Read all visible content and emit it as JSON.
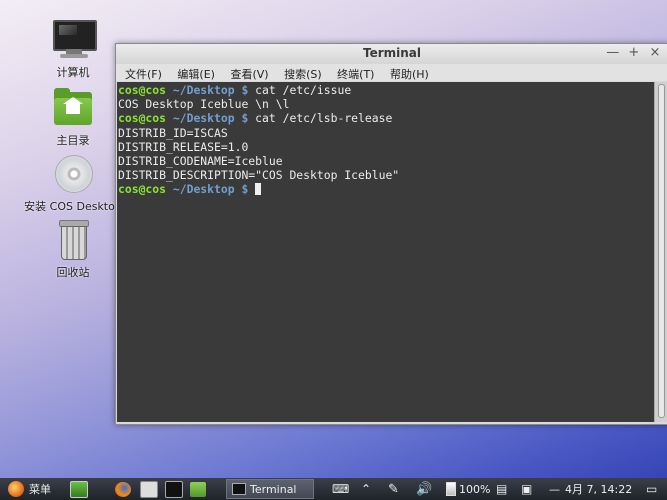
{
  "desktop": {
    "icons": [
      {
        "label": "计算机"
      },
      {
        "label": "主目录"
      },
      {
        "label": "安装 COS Desktop"
      },
      {
        "label": "回收站"
      }
    ]
  },
  "window": {
    "title": "Terminal",
    "buttons": {
      "minimize": "—",
      "maximize": "+",
      "close": "×"
    },
    "menu": [
      "文件(F)",
      "编辑(E)",
      "查看(V)",
      "搜索(S)",
      "终端(T)",
      "帮助(H)"
    ]
  },
  "terminal": {
    "prompt_user": "cos@cos",
    "prompt_path": "~/Desktop $",
    "lines": [
      {
        "type": "cmd",
        "text": " cat /etc/issue"
      },
      {
        "type": "out",
        "text": "COS Desktop Iceblue \\n \\l"
      },
      {
        "type": "cmd",
        "text": " cat /etc/lsb-release"
      },
      {
        "type": "out",
        "text": "DISTRIB_ID=ISCAS"
      },
      {
        "type": "out",
        "text": "DISTRIB_RELEASE=1.0"
      },
      {
        "type": "out",
        "text": "DISTRIB_CODENAME=Iceblue"
      },
      {
        "type": "out",
        "text": "DISTRIB_DESCRIPTION=\"COS Desktop Iceblue\""
      },
      {
        "type": "cmd",
        "text": " "
      }
    ]
  },
  "taskbar": {
    "menu_label": "菜单",
    "task_label": "Terminal",
    "battery": "100%",
    "clock": "4月 7, 14:22",
    "tray_minimize": "—"
  }
}
